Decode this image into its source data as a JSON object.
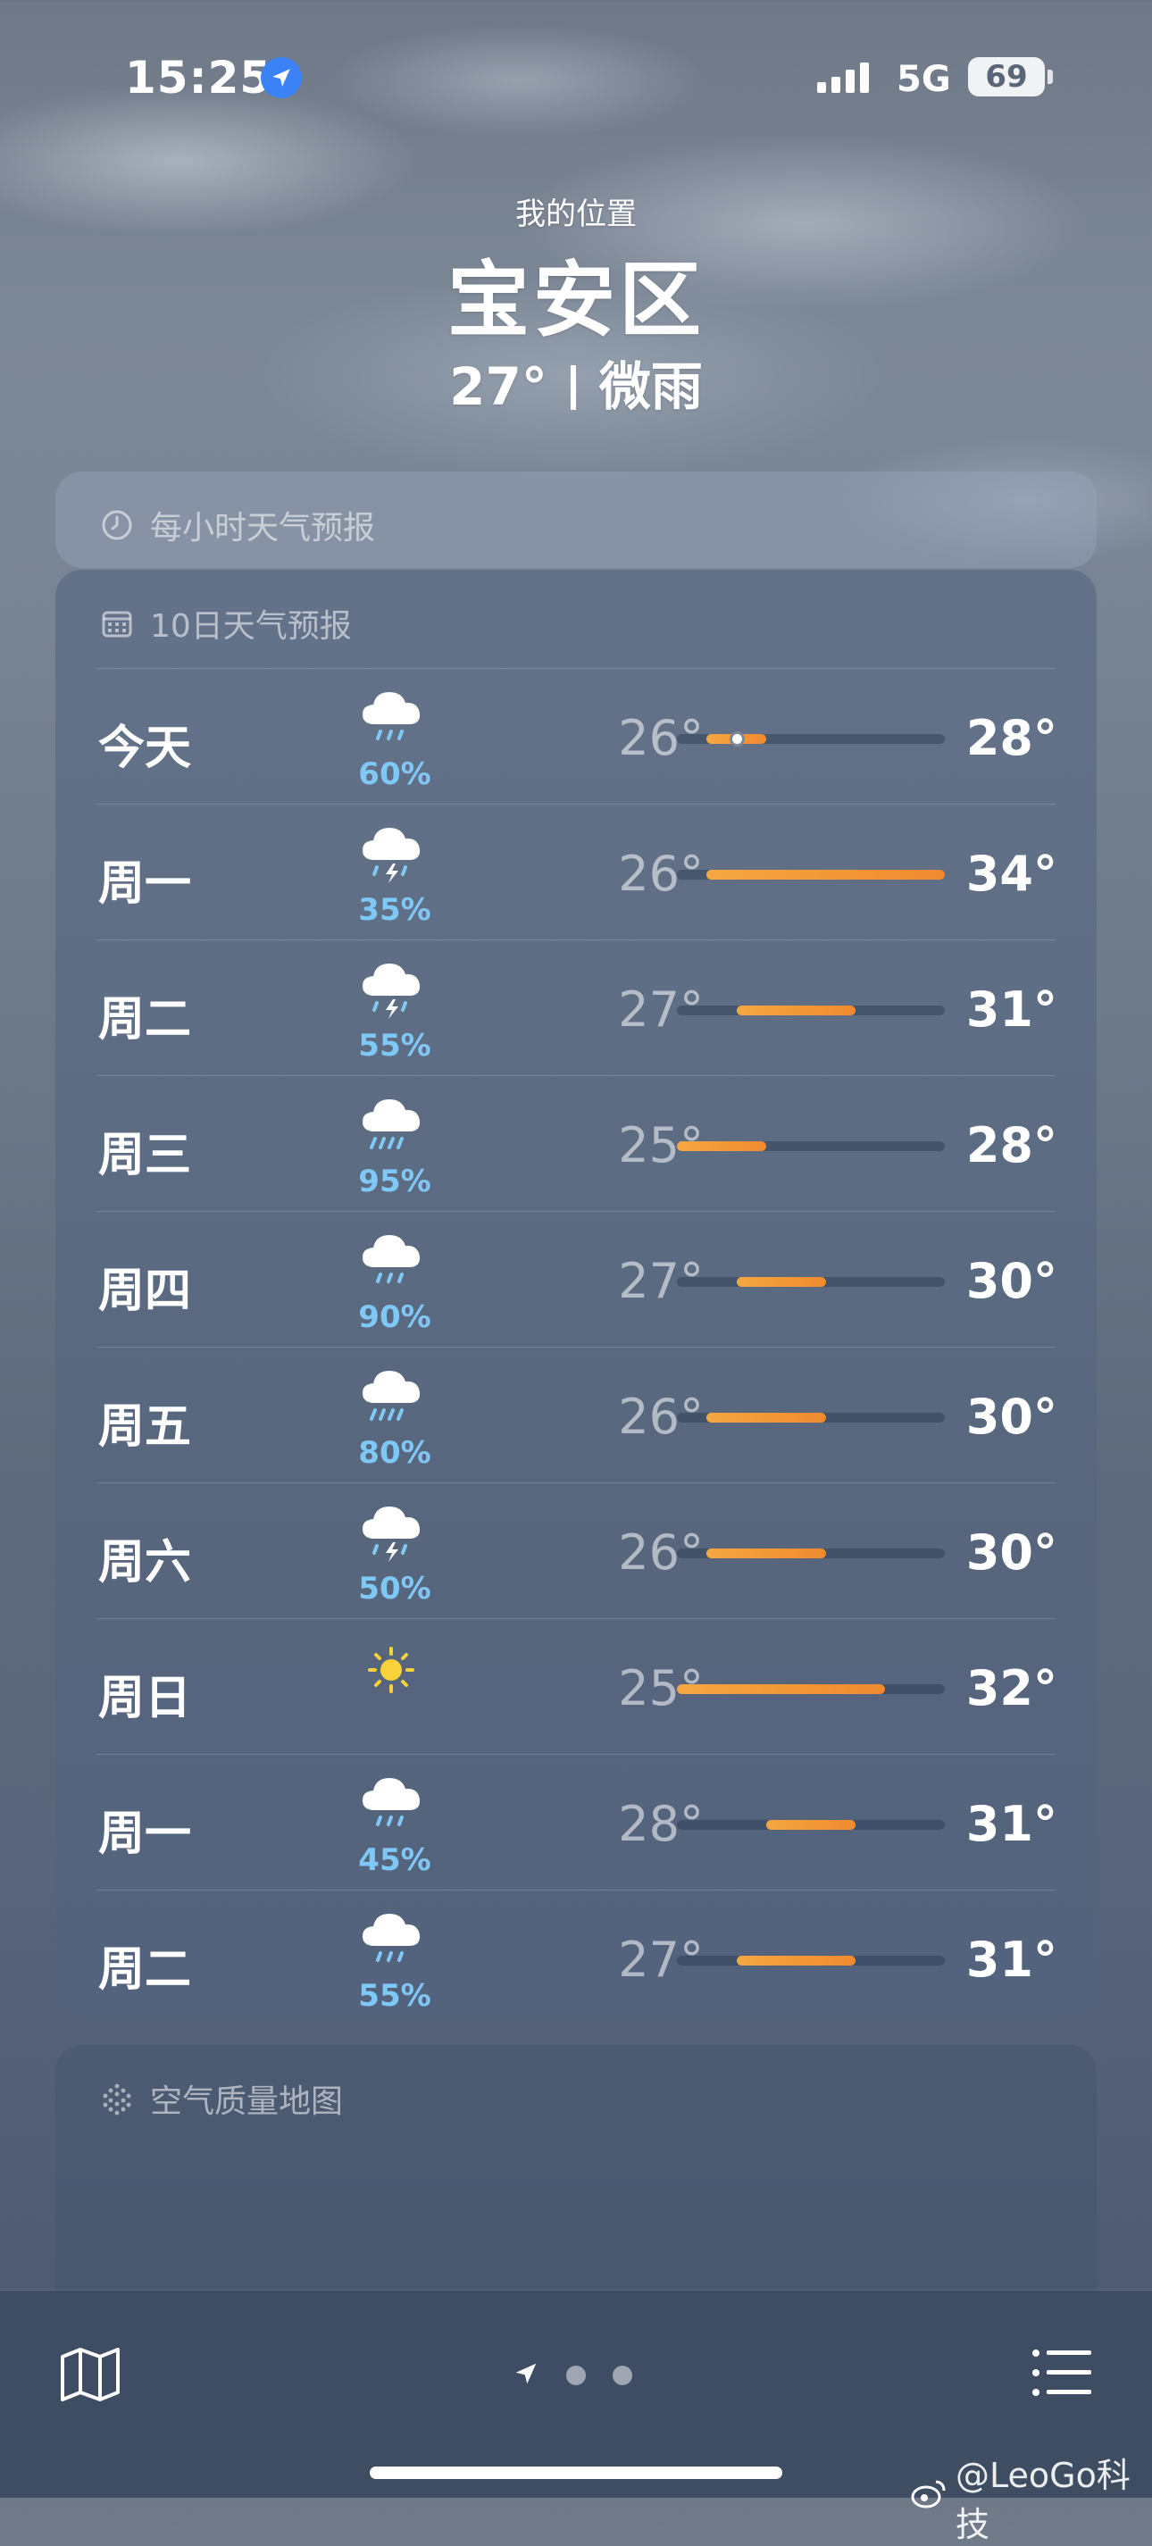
{
  "status_bar": {
    "time": "15:25",
    "network": "5G",
    "battery": "69"
  },
  "header": {
    "location_label": "我的位置",
    "city": "宝安区",
    "current_temp": "27°",
    "condition": "微雨"
  },
  "hourly_card": {
    "title": "每小时天气预报"
  },
  "daily_card": {
    "title": "10日天气预报",
    "range_min": 25,
    "range_max": 34,
    "days": [
      {
        "day": "今天",
        "icon": "rain-cloud-icon",
        "precip": "60%",
        "low": "26°",
        "high": "28°",
        "low_val": 26,
        "high_val": 28,
        "current": 27
      },
      {
        "day": "周一",
        "icon": "thunderstorm-cloud-icon",
        "precip": "35%",
        "low": "26°",
        "high": "34°",
        "low_val": 26,
        "high_val": 34
      },
      {
        "day": "周二",
        "icon": "thunderstorm-cloud-icon",
        "precip": "55%",
        "low": "27°",
        "high": "31°",
        "low_val": 27,
        "high_val": 31
      },
      {
        "day": "周三",
        "icon": "heavy-rain-cloud-icon",
        "precip": "95%",
        "low": "25°",
        "high": "28°",
        "low_val": 25,
        "high_val": 28
      },
      {
        "day": "周四",
        "icon": "rain-cloud-icon",
        "precip": "90%",
        "low": "27°",
        "high": "30°",
        "low_val": 27,
        "high_val": 30
      },
      {
        "day": "周五",
        "icon": "heavy-rain-cloud-icon",
        "precip": "80%",
        "low": "26°",
        "high": "30°",
        "low_val": 26,
        "high_val": 30
      },
      {
        "day": "周六",
        "icon": "thunderstorm-cloud-icon",
        "precip": "50%",
        "low": "26°",
        "high": "30°",
        "low_val": 26,
        "high_val": 30
      },
      {
        "day": "周日",
        "icon": "sun-icon",
        "precip": "",
        "low": "25°",
        "high": "32°",
        "low_val": 25,
        "high_val": 32
      },
      {
        "day": "周一",
        "icon": "rain-cloud-icon",
        "precip": "45%",
        "low": "28°",
        "high": "31°",
        "low_val": 28,
        "high_val": 31
      },
      {
        "day": "周二",
        "icon": "rain-cloud-icon",
        "precip": "55%",
        "low": "27°",
        "high": "31°",
        "low_val": 27,
        "high_val": 31
      }
    ]
  },
  "air_card": {
    "title": "空气质量地图"
  },
  "toolbar": {
    "map_icon": "map-icon",
    "location_icon": "location-arrow-icon",
    "list_icon": "list-icon"
  },
  "watermark": {
    "text": "@LeoGo科技"
  },
  "colors": {
    "precip": "#7fc8f5",
    "bar_start": "#f5a742",
    "bar_end": "#f08a30",
    "location_blue": "#3b82f6"
  }
}
